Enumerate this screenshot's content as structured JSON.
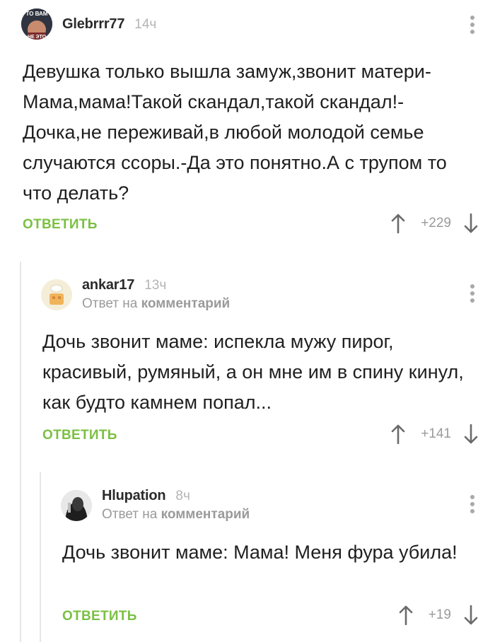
{
  "comments": [
    {
      "username": "Glebrrr77",
      "time": "14ч",
      "avatar_text": [
        "ТО ВАМ",
        "НЕ ЭТО"
      ],
      "text": "Девушка только вышла замуж,звонит матери-Мама,мама!Такой скандал,такой скандал!-Дочка,не переживай,в любой молодой семье случаются ссоры.-Да это понятно.А с трупом то что делать?",
      "reply_label": "ОТВЕТИТЬ",
      "votes": "+229"
    },
    {
      "username": "ankar17",
      "time": "13ч",
      "reply_prefix": "Ответ на",
      "reply_target": "комментарий",
      "text": "Дочь звонит маме: испекла мужу пирог, красивый, румяный, а он мне им в спину кинул, как будто камнем попал...",
      "reply_label": "ОТВЕТИТЬ",
      "votes": "+141"
    },
    {
      "username": "Hlupation",
      "time": "8ч",
      "reply_prefix": "Ответ на",
      "reply_target": "комментарий",
      "text": "Дочь звонит маме: Мама! Меня фура убила!",
      "reply_label": "ОТВЕТИТЬ",
      "votes": "+19"
    }
  ],
  "colors": {
    "accent": "#7bc043",
    "muted": "#9a9a9a",
    "thread_line": "#e6e6e6"
  },
  "icons": [
    "more-vert-icon",
    "arrow-up-icon",
    "arrow-down-icon"
  ]
}
